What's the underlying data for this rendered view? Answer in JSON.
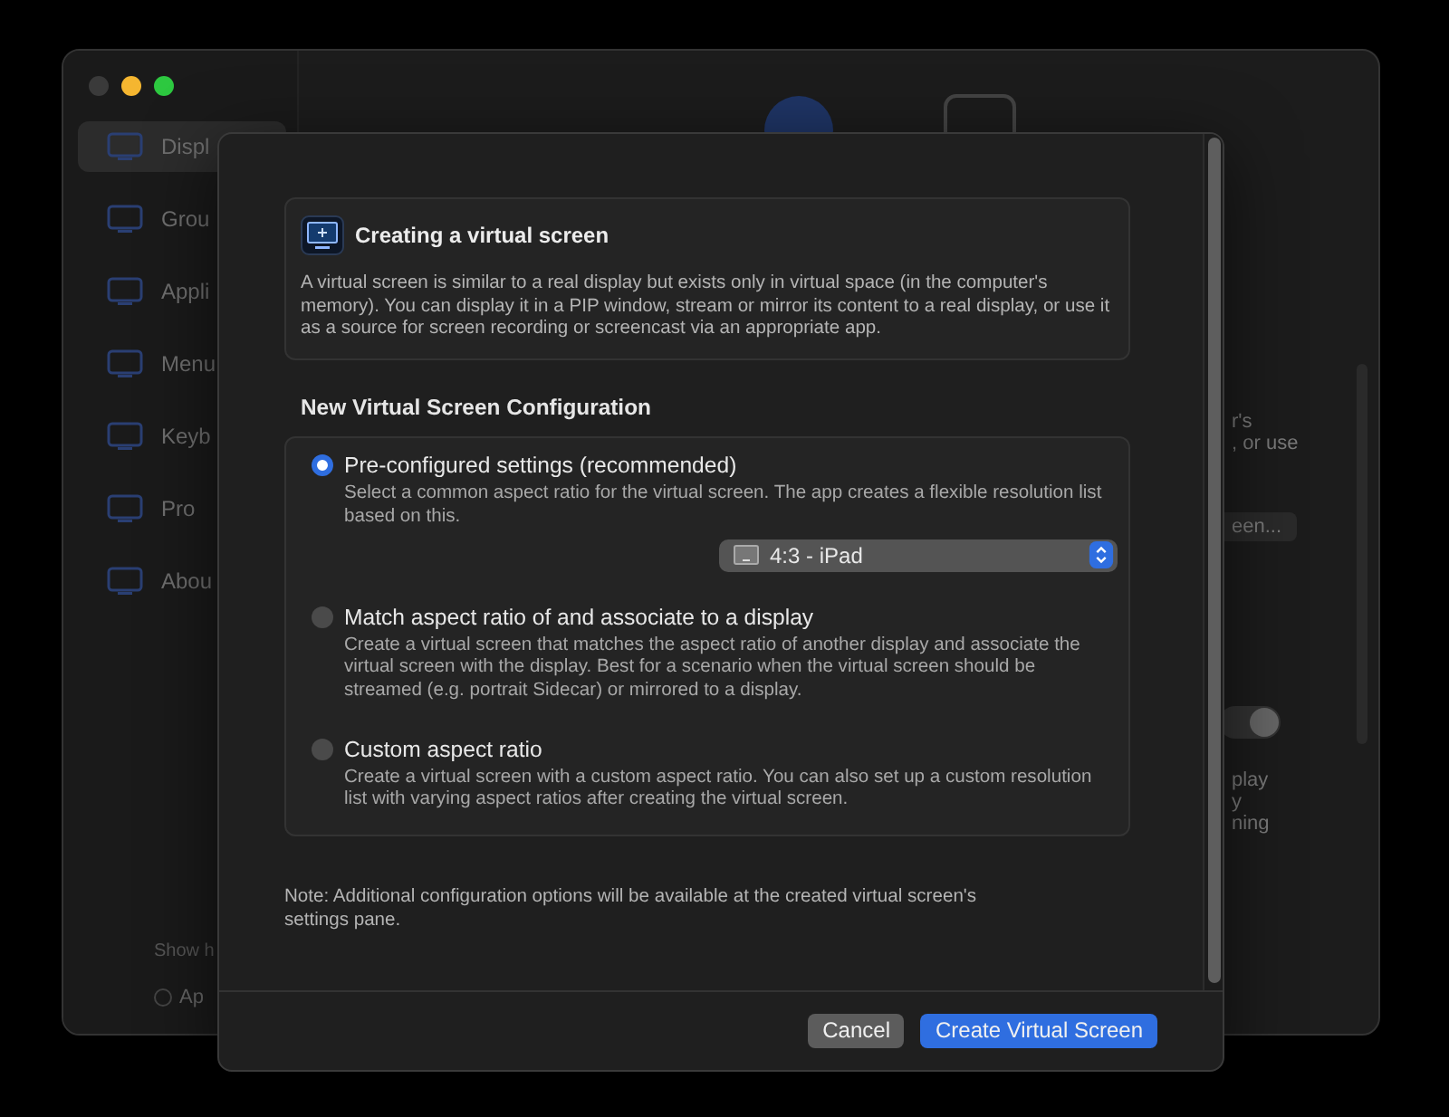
{
  "background_window": {
    "sidebar": {
      "items": [
        {
          "label": "Displ",
          "selected": true
        },
        {
          "label": "Grou",
          "selected": false
        },
        {
          "label": "Appli",
          "selected": false
        },
        {
          "label": "Menu",
          "selected": false
        },
        {
          "label": "Keyb",
          "selected": false
        },
        {
          "label": "Pro",
          "selected": false
        },
        {
          "label": "Abou",
          "selected": false
        }
      ],
      "footer_label": "Show h",
      "footer_item": "Ap",
      "footer_item_selected": false
    },
    "content_fragments": [
      "r's",
      ", or use"
    ],
    "button": "een...",
    "toggle_on": true,
    "toggle_caption": [
      "play",
      "y",
      "ning"
    ]
  },
  "sheet": {
    "info": {
      "title": "Creating a virtual screen",
      "description": "A virtual screen is similar to a real display but exists only in virtual space (in the computer's memory). You can display it in a PIP window, stream or mirror its content to a real display, or use it as a source for screen recording or screencast via an appropriate app."
    },
    "section_title": "New Virtual Screen Configuration",
    "options": [
      {
        "label": "Pre-configured settings (recommended)",
        "description": "Select a common aspect ratio for the virtual screen. The app creates a flexible resolution list based on this.",
        "selected": true,
        "popup": "4:3 - iPad"
      },
      {
        "label": "Match aspect ratio of and associate to a display",
        "description": "Create a virtual screen that matches the aspect ratio of another display and associate the virtual screen with the display. Best for a scenario when the virtual screen should be streamed (e.g. portrait Sidecar) or mirrored to a display.",
        "selected": false
      },
      {
        "label": "Custom aspect ratio",
        "description": "Create a virtual screen with a custom aspect ratio. You can also set up a custom resolution list with varying aspect ratios after creating the virtual screen.",
        "selected": false
      }
    ],
    "note": "Note: Additional configuration options will be available at the created virtual screen's settings pane.",
    "buttons": [
      {
        "label": "Cancel",
        "kind": "cancel"
      },
      {
        "label": "Create Virtual Screen",
        "kind": "default"
      }
    ]
  }
}
